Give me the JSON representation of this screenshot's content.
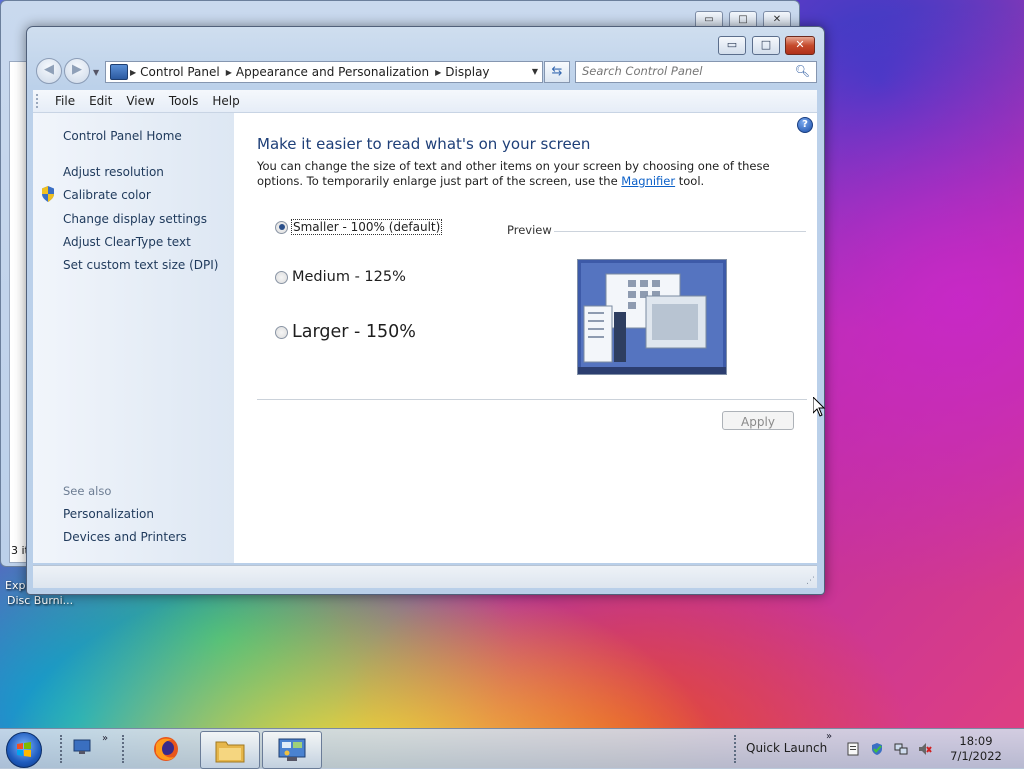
{
  "desktop": {
    "labels": [
      "Exp",
      "Disc Burni..."
    ],
    "side_text": "3 it"
  },
  "window": {
    "controls": {
      "minimize": "▭",
      "maximize": "□",
      "close": "✕"
    },
    "nav": {
      "back": "◀",
      "forward": "▶"
    },
    "address": {
      "segments": [
        "Control Panel",
        "Appearance and Personalization",
        "Display"
      ]
    },
    "search": {
      "placeholder": "Search Control Panel"
    },
    "menu": {
      "file": "File",
      "edit": "Edit",
      "view": "View",
      "tools": "Tools",
      "help": "Help"
    },
    "left_pane": {
      "home": "Control Panel Home",
      "items": [
        "Adjust resolution",
        "Calibrate color",
        "Change display settings",
        "Adjust ClearType text",
        "Set custom text size (DPI)"
      ],
      "see_also_label": "See also",
      "see_also": [
        "Personalization",
        "Devices and Printers"
      ]
    },
    "main": {
      "heading": "Make it easier to read what's on your screen",
      "desc_before": "You can change the size of text and other items on your screen by choosing one of these options. To temporarily enlarge just part of the screen, use the ",
      "desc_link": "Magnifier",
      "desc_after": " tool.",
      "options": [
        {
          "label": "Smaller - 100% (default)",
          "checked": true
        },
        {
          "label": "Medium - 125%",
          "checked": false
        },
        {
          "label": "Larger - 150%",
          "checked": false
        }
      ],
      "preview_label": "Preview",
      "apply": "Apply"
    }
  },
  "taskbar": {
    "quick_launch": "Quick Launch",
    "time": "18:09",
    "date": "7/1/2022"
  },
  "colors": {
    "heading": "#1e3f78",
    "link": "#1e395b",
    "accent": "#0b60c8"
  }
}
